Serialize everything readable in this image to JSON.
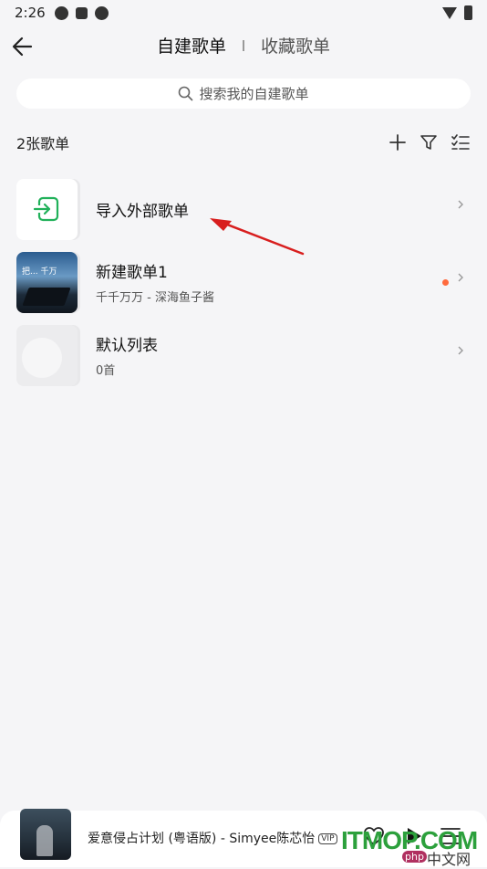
{
  "status": {
    "time": "2:26"
  },
  "header": {
    "tab_active": "自建歌单",
    "tab_inactive": "收藏歌单"
  },
  "search": {
    "placeholder": "搜索我的自建歌单"
  },
  "playlists_header": {
    "count": "2张歌单"
  },
  "items": [
    {
      "title": "导入外部歌单",
      "subtitle": ""
    },
    {
      "title": "新建歌单1",
      "subtitle": "千千万万 - 深海鱼子酱",
      "cover_text": "把... 千万"
    },
    {
      "title": "默认列表",
      "subtitle": "0首"
    }
  ],
  "player": {
    "song": "爱意侵占计划 (粤语版) - Simyee陈芯怡",
    "badge": "VIP"
  },
  "watermark": {
    "main": "ITMOP.COM",
    "php": "php",
    "cn": "中文网"
  },
  "colors": {
    "accent": "#21b15a",
    "dot": "#ff6a3d",
    "arrow": "#d81e1e"
  }
}
